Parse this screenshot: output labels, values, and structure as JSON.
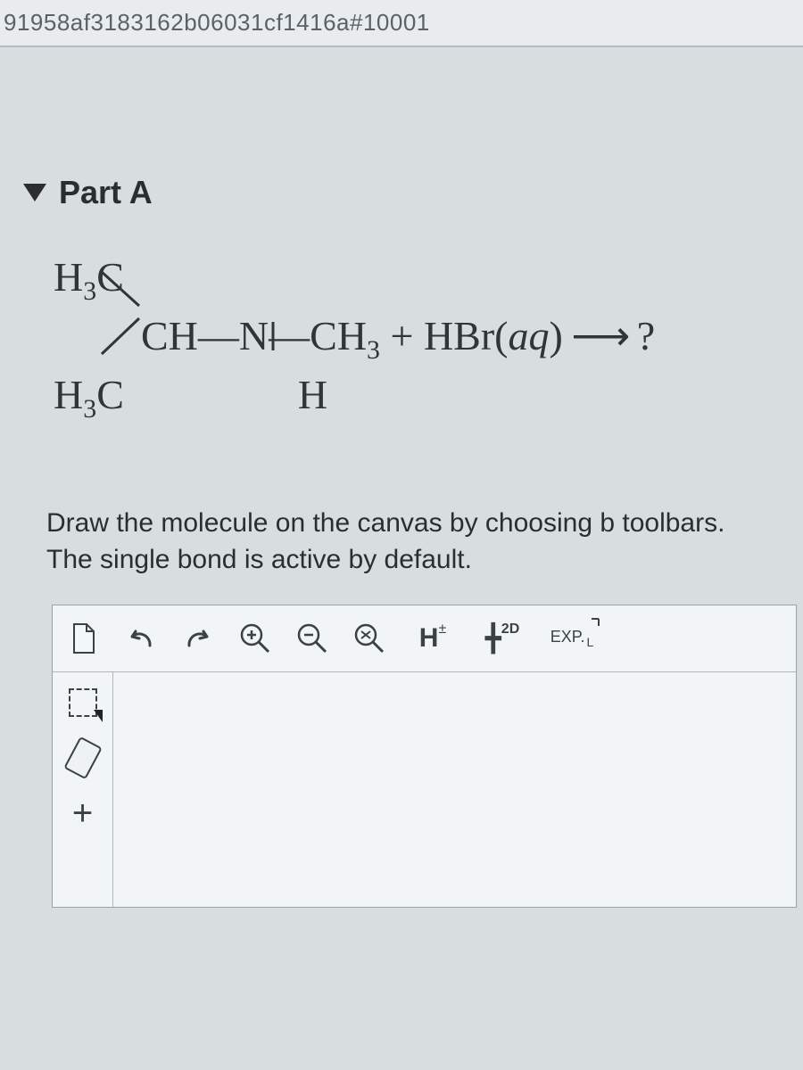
{
  "url_fragment": "91958af3183162b06031cf1416a#10001",
  "part": {
    "label": "Part A"
  },
  "equation": {
    "line1_left": "H",
    "line1_left_sub": "3",
    "line1_left_tail": "C",
    "line2_frag1": "CH",
    "line2_bond1": "—",
    "line2_frag2": "N",
    "line2_bond2": "—",
    "line2_frag3": "CH",
    "line2_frag3_sub": "3",
    "line2_plus": " + ",
    "line2_reagent": "HBr(",
    "line2_reagent_state": "aq",
    "line2_reagent_close": ")",
    "line2_arrow": " ⟶ ",
    "line2_product": "?",
    "line3_left": "H",
    "line3_left_sub": "3",
    "line3_left_tail": "C",
    "line3_mid_H": "H"
  },
  "instructions_text": "Draw the molecule on the canvas by choosing b\ntoolbars. The single bond is active by default.",
  "toolbar": {
    "new_doc": "new-document",
    "undo": "undo",
    "redo": "redo",
    "zoom_in": "zoom-in",
    "zoom_out": "zoom-out",
    "zoom_reset": "zoom-reset",
    "hetero_H": "H",
    "hetero_pm": "±",
    "view2d_cross": "╋",
    "view2d_sup": "2D",
    "exp_label": "EXP.",
    "exp_sub": "L"
  },
  "sidebar": {
    "select": "select-marquee",
    "erase": "eraser",
    "add": "+"
  }
}
